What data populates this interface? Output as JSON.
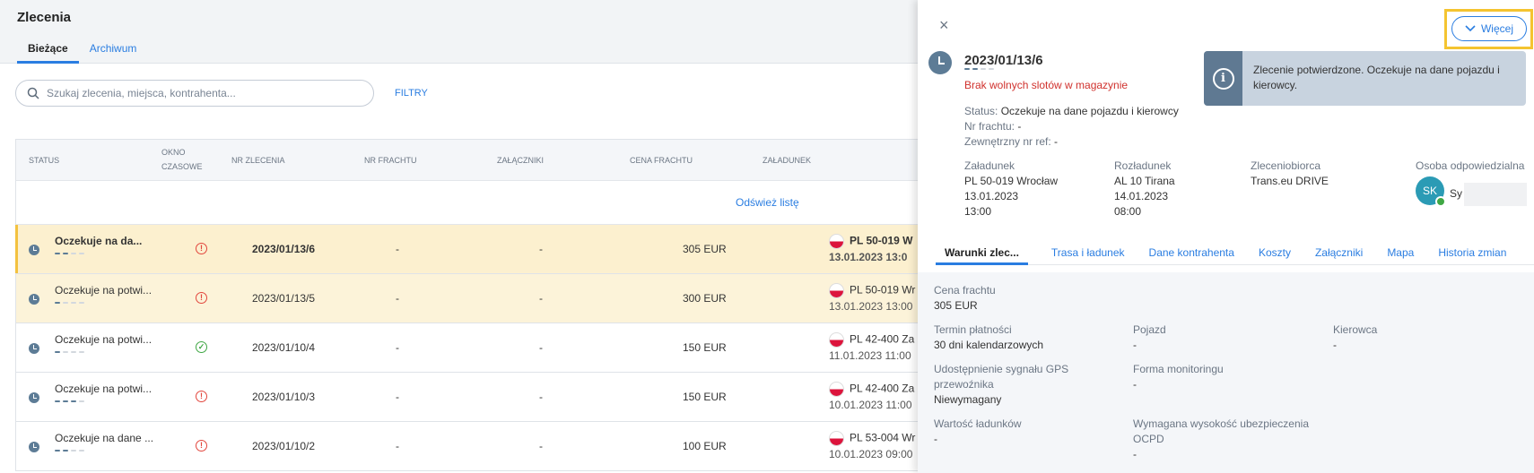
{
  "page": {
    "title": "Zlecenia",
    "tabs": [
      {
        "label": "Bieżące"
      },
      {
        "label": "Archiwum"
      }
    ],
    "search_placeholder": "Szukaj zlecenia, miejsca, kontrahenta...",
    "filters_label": "FILTRY"
  },
  "table": {
    "headers": {
      "status": "STATUS",
      "window": "OKNO CZASOWE",
      "order_nr": "NR ZLECENIA",
      "freight_nr": "NR FRACHTU",
      "attachments": "ZAŁĄCZNIKI",
      "price": "CENA FRACHTU",
      "loading": "ZAŁADUNEK"
    },
    "refresh_label": "Odśwież listę",
    "rows": [
      {
        "status": "Oczekuje na da...",
        "progress": 2,
        "window": "alert",
        "order_nr": "2023/01/13/6",
        "freight_nr": "-",
        "attachments": "-",
        "price": "305 EUR",
        "loading_place": "PL 50-019 W",
        "loading_date": "13.01.2023 13:0"
      },
      {
        "status": "Oczekuje na potwi...",
        "progress": 1,
        "window": "alert",
        "order_nr": "2023/01/13/5",
        "freight_nr": "-",
        "attachments": "-",
        "price": "300 EUR",
        "loading_place": "PL 50-019 Wr",
        "loading_date": "13.01.2023 13:00"
      },
      {
        "status": "Oczekuje na potwi...",
        "progress": 1,
        "window": "ok",
        "order_nr": "2023/01/10/4",
        "freight_nr": "-",
        "attachments": "-",
        "price": "150 EUR",
        "loading_place": "PL 42-400 Za",
        "loading_date": "11.01.2023 11:00"
      },
      {
        "status": "Oczekuje na potwi...",
        "progress": 3,
        "window": "alert",
        "order_nr": "2023/01/10/3",
        "freight_nr": "-",
        "attachments": "-",
        "price": "150 EUR",
        "loading_place": "PL 42-400 Za",
        "loading_date": "10.01.2023 11:00"
      },
      {
        "status": "Oczekuje na dane ...",
        "progress": 2,
        "window": "alert",
        "order_nr": "2023/01/10/2",
        "freight_nr": "-",
        "attachments": "-",
        "price": "100 EUR",
        "loading_place": "PL 53-004 Wr",
        "loading_date": "10.01.2023 09:00"
      }
    ]
  },
  "detail": {
    "close_icon": "×",
    "more_label": "Więcej",
    "order_nr": "2023/01/13/6",
    "progress": 2,
    "warning": "Brak wolnych slotów w magazynie",
    "status_label": "Status:",
    "status_value": "Oczekuje na dane pojazdu i kierowcy",
    "freight_label": "Nr frachtu:",
    "freight_value": "-",
    "ext_ref_label": "Zewnętrzny nr ref:",
    "ext_ref_value": "-",
    "info": "Zlecenie potwierdzone. Oczekuje na dane pojazdu i kierowcy.",
    "loading": {
      "label": "Załadunek",
      "place": "PL 50-019 Wrocław",
      "date": "13.01.2023",
      "time": "13:00"
    },
    "unloading": {
      "label": "Rozładunek",
      "place": "AL 10 Tirana",
      "date": "14.01.2023",
      "time": "08:00"
    },
    "contractor": {
      "label": "Zleceniobiorca",
      "value": "Trans.eu DRIVE"
    },
    "person": {
      "label": "Osoba odpowiedzialna",
      "initials": "SK",
      "name": "Sy"
    },
    "tabs": [
      "Warunki zlec...",
      "Trasa i ładunek",
      "Dane kontrahenta",
      "Koszty",
      "Załączniki",
      "Mapa",
      "Historia zmian"
    ],
    "fields": {
      "price": {
        "label": "Cena frachtu",
        "value": "305 EUR"
      },
      "payment": {
        "label": "Termin płatności",
        "value": "30 dni kalendarzowych"
      },
      "vehicle": {
        "label": "Pojazd",
        "value": "-"
      },
      "driver": {
        "label": "Kierowca",
        "value": "-"
      },
      "gps_label_1": "Udostępnienie sygnału GPS",
      "gps_label_2": "przewoźnika",
      "gps_value": "Niewymagany",
      "monitoring": {
        "label": "Forma monitoringu",
        "value": "-"
      },
      "cargo_value": {
        "label": "Wartość ładunków",
        "value": "-"
      },
      "insurance_label": "Wymagana wysokość ubezpieczenia",
      "insurance_sub": "OCPD",
      "insurance_value": "-"
    }
  }
}
